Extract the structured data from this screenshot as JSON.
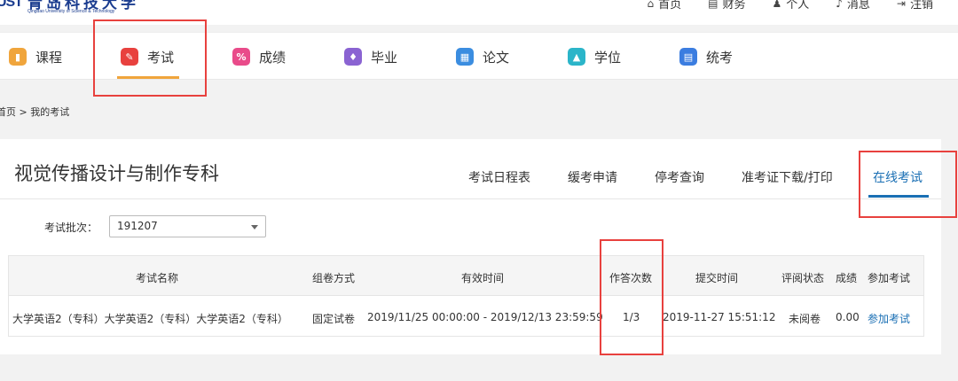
{
  "header": {
    "logo_badge": "UST",
    "logo_cn": "青岛科技大学",
    "logo_en": "Qingdao University of Science & Technology",
    "links": [
      {
        "icon": "home-icon",
        "glyph": "⌂",
        "label": "首页"
      },
      {
        "icon": "finance-icon",
        "glyph": "▤",
        "label": "财务"
      },
      {
        "icon": "user-icon",
        "glyph": "♟",
        "label": "个人"
      },
      {
        "icon": "bell-icon",
        "glyph": "♪",
        "label": "消息"
      },
      {
        "icon": "logout-icon",
        "glyph": "⇥",
        "label": "注销"
      }
    ]
  },
  "nav": {
    "items": [
      {
        "label": "课程",
        "icon": "course-icon",
        "color": "#f0a53c"
      },
      {
        "label": "考试",
        "icon": "exam-icon",
        "color": "#e8413e"
      },
      {
        "label": "成绩",
        "icon": "score-icon",
        "color": "#e94b8a"
      },
      {
        "label": "毕业",
        "icon": "graduation-icon",
        "color": "#8a63d2"
      },
      {
        "label": "论文",
        "icon": "thesis-icon",
        "color": "#3b8de0"
      },
      {
        "label": "学位",
        "icon": "degree-icon",
        "color": "#2bb5c9"
      },
      {
        "label": "统考",
        "icon": "unified-exam-icon",
        "color": "#3b7de0"
      }
    ],
    "active": "考试"
  },
  "breadcrumb": "首页 > 我的考试",
  "major": "视觉传播设计与制作专科",
  "tabs": [
    "考试日程表",
    "缓考申请",
    "停考查询",
    "准考证下载/打印",
    "在线考试"
  ],
  "active_tab": "在线考试",
  "batch": {
    "label": "考试批次：",
    "value": "191207"
  },
  "table": {
    "headers": [
      "考试名称",
      "组卷方式",
      "有效时间",
      "作答次数",
      "提交时间",
      "评阅状态",
      "成绩",
      "参加考试"
    ],
    "rows": [
      [
        "大学英语2（专科）大学英语2（专科）大学英语2（专科）",
        "固定试卷",
        "2019/11/25 00:00:00 - 2019/12/13 23:59:59",
        "1/3",
        "2019-11-27 15:51:12",
        "未阅卷",
        "0.00",
        "参加考试"
      ]
    ]
  },
  "colors": {
    "accent": "#1a6fb4",
    "highlight": "#e8413e",
    "nav_underline": "#f0a53c"
  }
}
